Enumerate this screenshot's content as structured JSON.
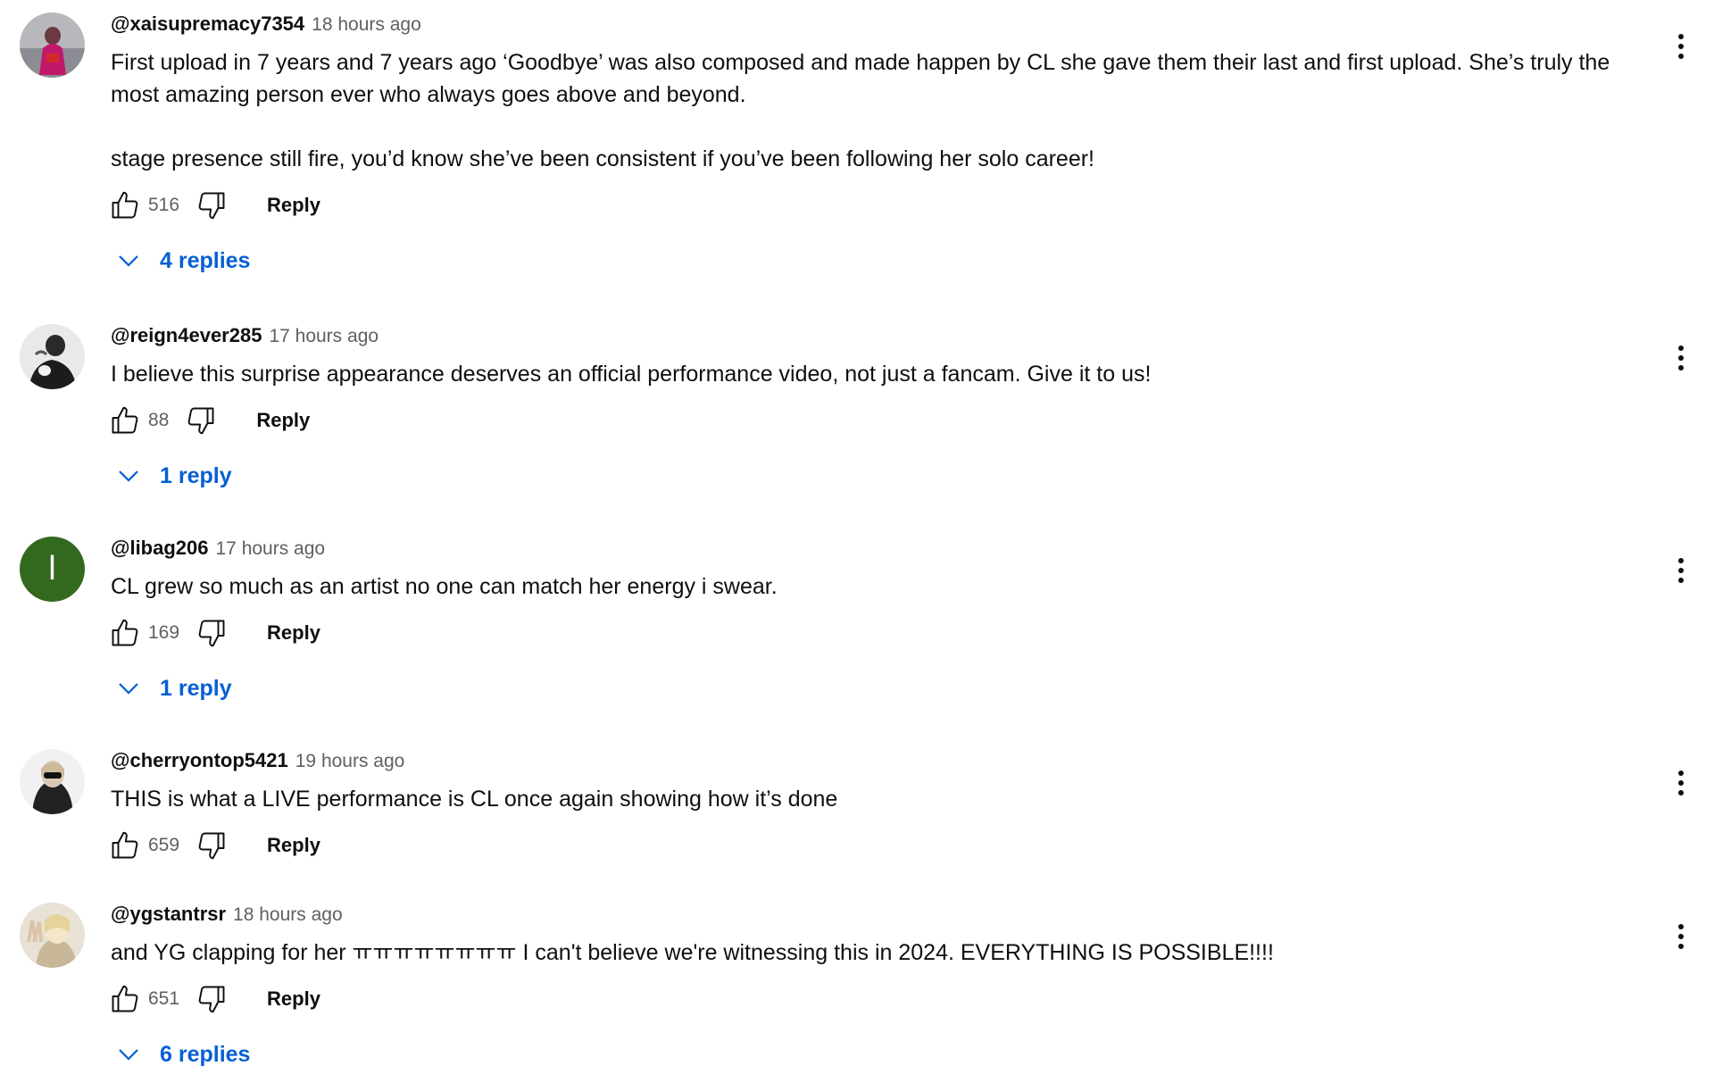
{
  "colors": {
    "link_blue": "#065fd4",
    "muted_text": "#606060",
    "primary_text": "#0f0f0f",
    "letter_avatar_bg": "#33691e"
  },
  "comments": [
    {
      "author": "@xaisupremacy7354",
      "time": "18 hours ago",
      "text": "First upload in 7 years and 7 years ago ‘Goodbye’ was also composed and made happen by CL she gave them their last and first upload. She’s truly the most amazing person ever who always goes above and beyond.\n\nstage presence still fire, you’d know she’ve been consistent if you’ve been following her solo career!",
      "likes": "516",
      "reply_label": "Reply",
      "replies_label": "4 replies",
      "avatar": "photo"
    },
    {
      "author": "@reign4ever285",
      "time": "17 hours ago",
      "text": "I believe this surprise appearance deserves an official performance video, not just a fancam. Give it to us!",
      "likes": "88",
      "reply_label": "Reply",
      "replies_label": "1 reply",
      "avatar": "photo"
    },
    {
      "author": "@libag206",
      "time": "17 hours ago",
      "text": "CL grew so much as an artist no one can match her energy i swear.",
      "likes": "169",
      "reply_label": "Reply",
      "replies_label": "1 reply",
      "avatar": "letter",
      "avatar_letter": "l"
    },
    {
      "author": "@cherryontop5421",
      "time": "19 hours ago",
      "text": "THIS is what a LIVE performance is CL once again showing how it’s done",
      "likes": "659",
      "reply_label": "Reply",
      "avatar": "photo"
    },
    {
      "author": "@ygstantrsr",
      "time": "18 hours ago",
      "text": "and YG clapping for her ㅠㅠㅠㅠㅠㅠㅠㅠ I can't believe we're witnessing this in 2024. EVERYTHING IS POSSIBLE!!!!",
      "likes": "651",
      "reply_label": "Reply",
      "replies_label": "6 replies",
      "avatar": "photo"
    }
  ]
}
